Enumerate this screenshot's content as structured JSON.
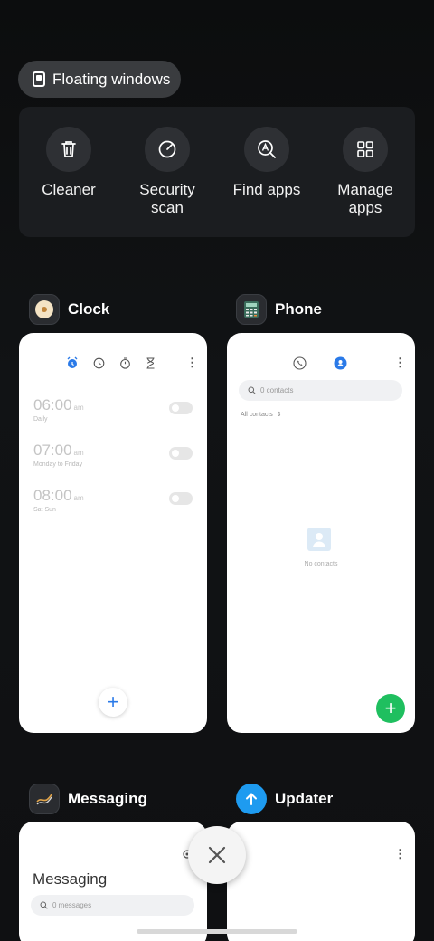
{
  "floating_windows": {
    "label": "Floating windows"
  },
  "quick_actions": [
    {
      "label": "Cleaner",
      "icon": "trash-icon"
    },
    {
      "label": "Security\nscan",
      "icon": "security-scan-icon"
    },
    {
      "label": "Find apps",
      "icon": "find-apps-icon"
    },
    {
      "label": "Manage\napps",
      "icon": "grid-icon"
    }
  ],
  "apps": {
    "clock": {
      "name": "Clock",
      "alarms": [
        {
          "time": "06:00",
          "ampm": "am",
          "repeat": "Daily"
        },
        {
          "time": "07:00",
          "ampm": "am",
          "repeat": "Monday to Friday"
        },
        {
          "time": "08:00",
          "ampm": "am",
          "repeat": "Sat Sun"
        }
      ],
      "accent": "#2a7ae8"
    },
    "phone": {
      "name": "Phone",
      "search_placeholder": "0 contacts",
      "filter": "All contacts",
      "empty_text": "No contacts",
      "fab_color": "#1fbf5f"
    },
    "messaging": {
      "name": "Messaging",
      "title": "Messaging",
      "search_placeholder": "0 messages"
    },
    "updater": {
      "name": "Updater",
      "icon_color": "#1e9bf0"
    }
  }
}
